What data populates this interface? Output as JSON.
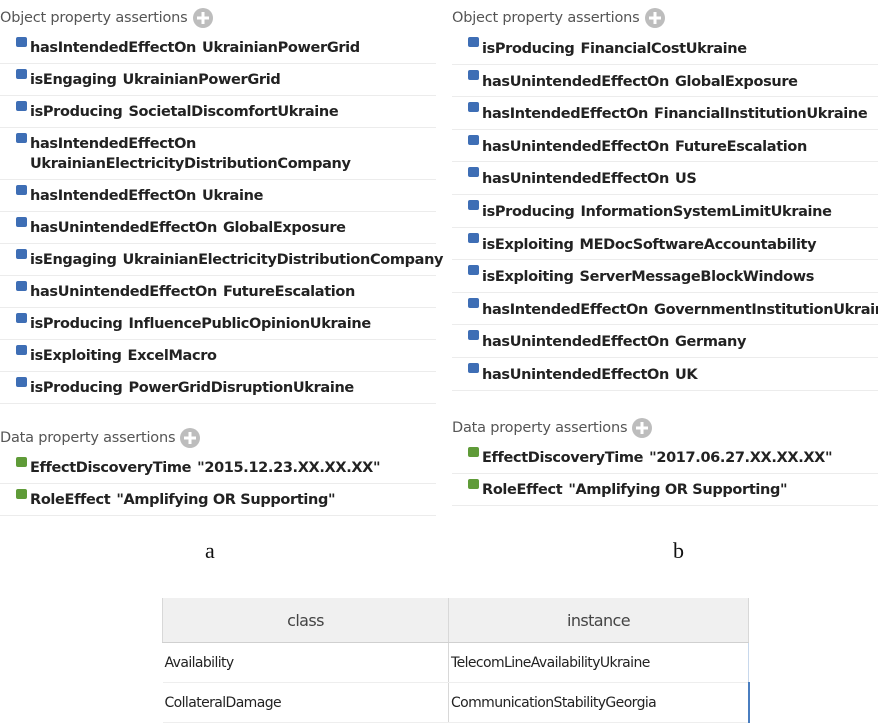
{
  "panel_a": {
    "object_header": "Object property assertions",
    "object_assertions": [
      {
        "property": "hasIntendedEffectOn",
        "value": "UkrainianPowerGrid"
      },
      {
        "property": "isEngaging",
        "value": "UkrainianPowerGrid"
      },
      {
        "property": "isProducing",
        "value": "SocietalDiscomfortUkraine"
      },
      {
        "property": "hasIntendedEffectOn",
        "value": "UkrainianElectricityDistributionCompany"
      },
      {
        "property": "hasIntendedEffectOn",
        "value": "Ukraine"
      },
      {
        "property": "hasUnintendedEffectOn",
        "value": "GlobalExposure"
      },
      {
        "property": "isEngaging",
        "value": "UkrainianElectricityDistributionCompany"
      },
      {
        "property": "hasUnintendedEffectOn",
        "value": "FutureEscalation"
      },
      {
        "property": "isProducing",
        "value": "InfluencePublicOpinionUkraine"
      },
      {
        "property": "isExploiting",
        "value": "ExcelMacro"
      },
      {
        "property": "isProducing",
        "value": "PowerGridDisruptionUkraine"
      }
    ],
    "data_header": "Data property assertions",
    "data_assertions": [
      {
        "property": "EffectDiscoveryTime",
        "value": "\"2015.12.23.XX.XX.XX\""
      },
      {
        "property": "RoleEffect",
        "value": "\"Amplifying OR Supporting\""
      }
    ],
    "caption": "a"
  },
  "panel_b": {
    "object_header": "Object property assertions",
    "object_assertions": [
      {
        "property": "isProducing",
        "value": "FinancialCostUkraine"
      },
      {
        "property": "hasUnintendedEffectOn",
        "value": "GlobalExposure"
      },
      {
        "property": "hasIntendedEffectOn",
        "value": "FinancialInstitutionUkraine"
      },
      {
        "property": "hasUnintendedEffectOn",
        "value": "FutureEscalation"
      },
      {
        "property": "hasUnintendedEffectOn",
        "value": "US"
      },
      {
        "property": "isProducing",
        "value": "InformationSystemLimitUkraine"
      },
      {
        "property": "isExploiting",
        "value": "MEDocSoftwareAccountability"
      },
      {
        "property": "isExploiting",
        "value": "ServerMessageBlockWindows"
      },
      {
        "property": "hasIntendedEffectOn",
        "value": "GovernmentInstitutionUkraine"
      },
      {
        "property": "hasUnintendedEffectOn",
        "value": "Germany"
      },
      {
        "property": "hasUnintendedEffectOn",
        "value": "UK"
      }
    ],
    "data_header": "Data property assertions",
    "data_assertions": [
      {
        "property": "EffectDiscoveryTime",
        "value": "\"2017.06.27.XX.XX.XX\""
      },
      {
        "property": "RoleEffect",
        "value": "\"Amplifying OR Supporting\""
      }
    ],
    "caption": "b"
  },
  "table": {
    "headers": {
      "class": "class",
      "instance": "instance"
    },
    "rows": [
      {
        "class": "Availability",
        "instance": "TelecomLineAvailabilityUkraine"
      },
      {
        "class": "CollateralDamage",
        "instance": "CommunicationStabilityGeorgia"
      }
    ]
  },
  "colors": {
    "object_bullet": "#3e6eb5",
    "data_bullet": "#5f9b38",
    "add_icon": "#bdbdbd",
    "table_header_bg": "#f0f0f0",
    "selection_border": "#4a7ec0"
  },
  "icons": {
    "add": "add-circle-icon",
    "object_property": "object-property-icon",
    "data_property": "data-property-icon"
  }
}
